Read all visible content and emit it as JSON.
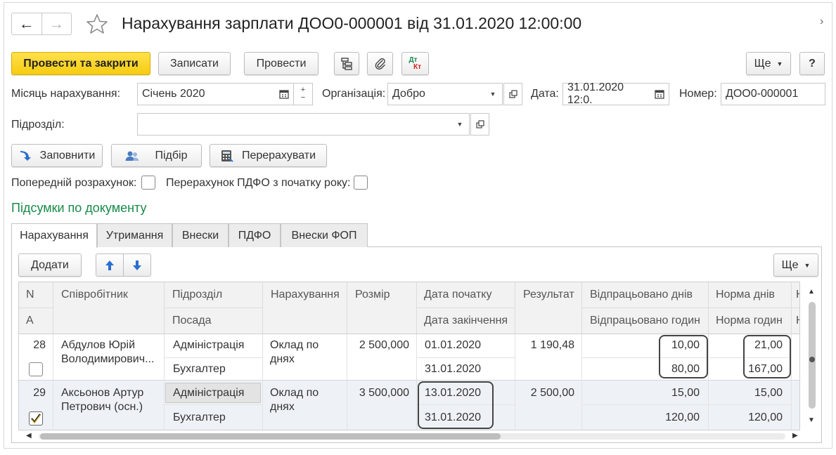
{
  "header": {
    "title": "Нарахування зарплати ДОО0-000001 від 31.01.2020 12:00:00"
  },
  "toolbar": {
    "post_close": "Провести та закрити",
    "save": "Записати",
    "post": "Провести",
    "dt_label": "Дт",
    "kt_label": "Кт",
    "more": "Ще",
    "help": "?"
  },
  "form": {
    "month_label": "Місяць нарахування:",
    "month_value": "Січень 2020",
    "org_label": "Організація:",
    "org_value": "Добро",
    "date_label": "Дата:",
    "date_value": "31.01.2020 12:0.",
    "number_label": "Номер:",
    "number_value": "ДОО0-000001",
    "dept_label": "Підрозділ:",
    "dept_value": ""
  },
  "actions": {
    "fill": "Заповнити",
    "select": "Підбір",
    "recalc": "Перерахувати"
  },
  "options": {
    "prelim_label": "Попередній розрахунок:",
    "prelim_checked": false,
    "pdfo_label": "Перерахунок ПДФО з початку року:",
    "pdfo_checked": false
  },
  "totals_link": "Підсумки по документу",
  "tabs": [
    "Нарахування",
    "Утримання",
    "Внески",
    "ПДФО",
    "Внески ФОП"
  ],
  "table_toolbar": {
    "add": "Додати",
    "more": "Ще"
  },
  "table": {
    "headers": {
      "n": "N",
      "a": "A",
      "employee": "Співробітник",
      "dept": "Підрозділ",
      "position": "Посада",
      "accrual": "Нарахування",
      "amount": "Розмір",
      "start_date": "Дата початку",
      "end_date": "Дата закінчення",
      "result": "Результат",
      "worked_days": "Відпрацьовано днів",
      "worked_hours": "Відпрацьовано годин",
      "norm_days": "Норма днів",
      "norm_hours": "Норма годин",
      "next1": "Н",
      "next2": "Н"
    },
    "rows": [
      {
        "n": "28",
        "employee_line1": "Абдулов Юрій",
        "employee_line2": "Володимирович...",
        "dept": "Адміністрація",
        "position": "Бухгалтер",
        "accrual_line1": "Оклад по",
        "accrual_line2": "днях",
        "amount": "2 500,000",
        "start_date": "01.01.2020",
        "end_date": "31.01.2020",
        "result": "1 190,48",
        "worked_days": "10,00",
        "worked_hours": "80,00",
        "norm_days": "21,00",
        "norm_hours": "167,00",
        "checked": false
      },
      {
        "n": "29",
        "employee_line1": "Аксьонов Артур",
        "employee_line2": "Петрович (осн.)",
        "dept": "Адміністрація",
        "position": "Бухгалтер",
        "accrual_line1": "Оклад по",
        "accrual_line2": "днях",
        "amount": "3 500,000",
        "start_date": "13.01.2020",
        "end_date": "31.01.2020",
        "result": "2 500,00",
        "worked_days": "15,00",
        "worked_hours": "120,00",
        "norm_days": "15,00",
        "norm_hours": "120,00",
        "checked": true
      }
    ]
  },
  "colors": {
    "primary_button": "#f6cb10",
    "link_green": "#1a8a4a",
    "selected_row": "#eef2f7",
    "arrow_blue": "#2a6fcf"
  }
}
